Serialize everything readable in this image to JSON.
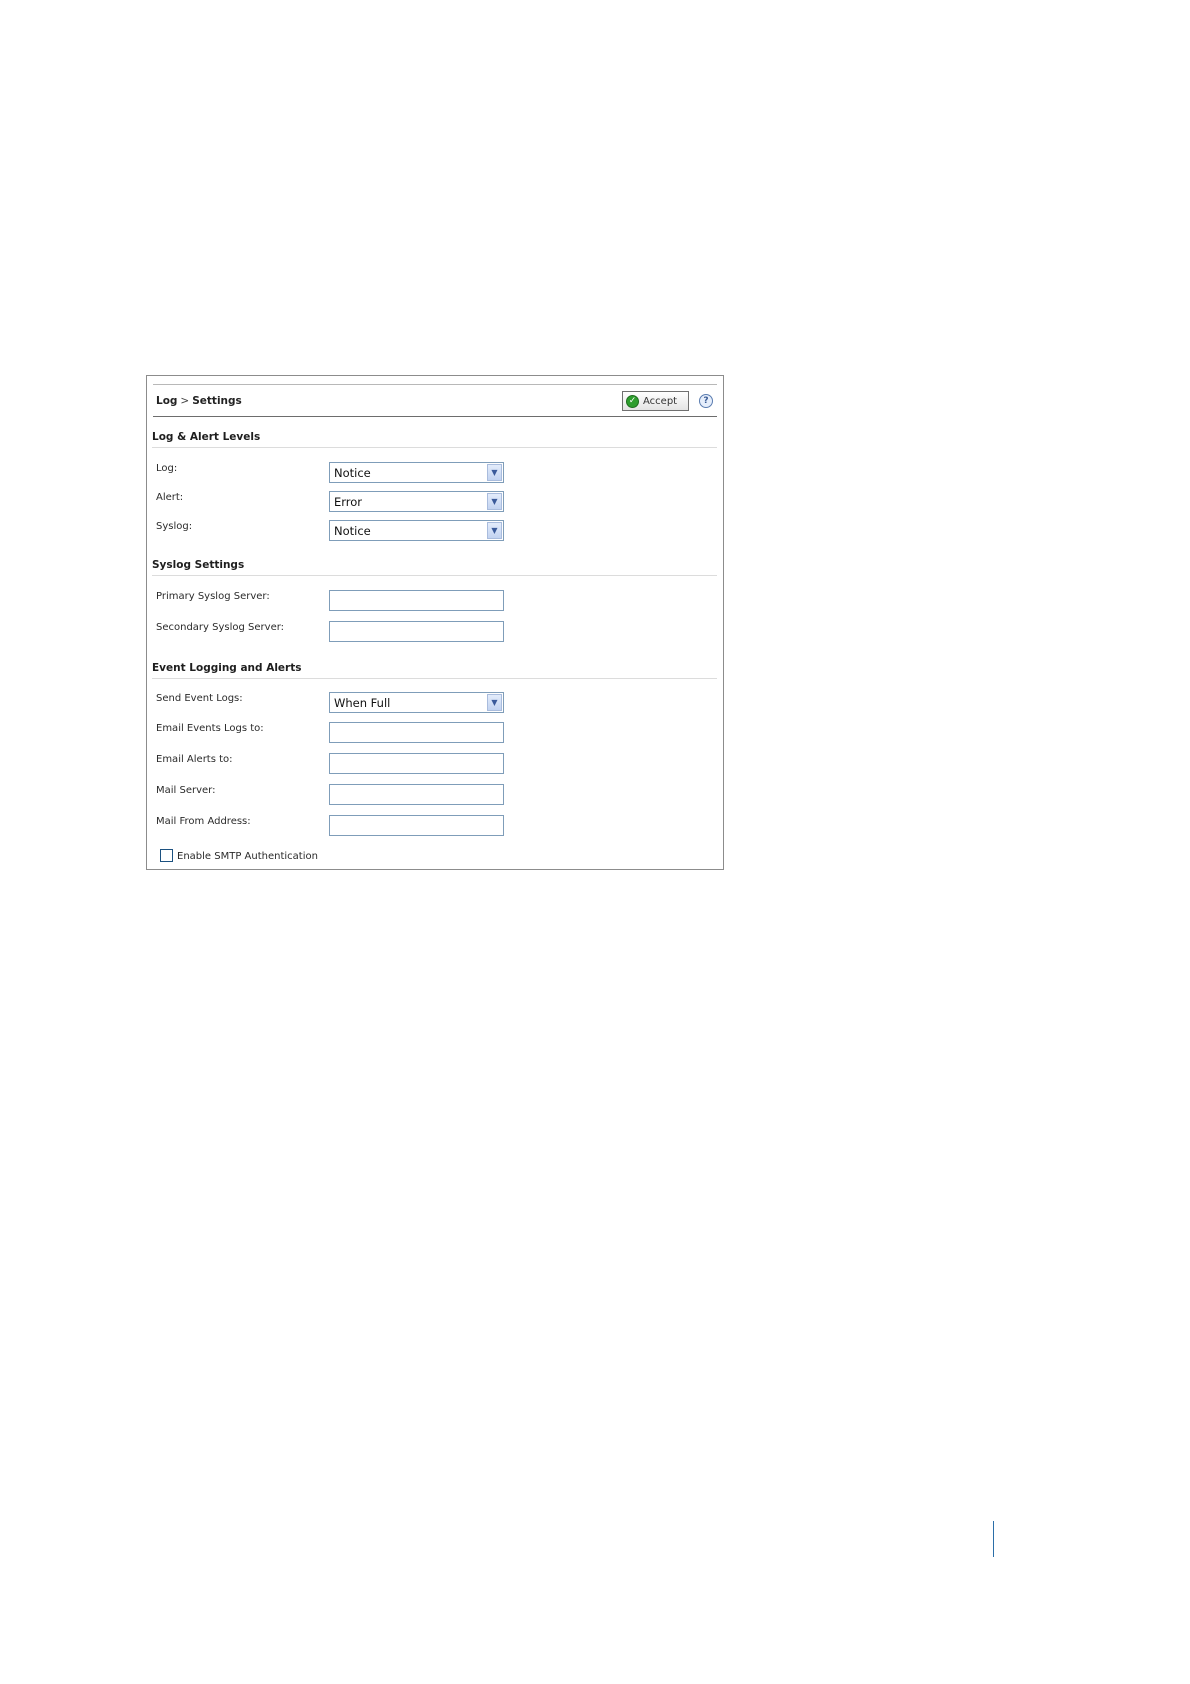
{
  "header": {
    "crumb_section": "Log",
    "crumb_separator": ">",
    "crumb_page": "Settings",
    "accept_label": "Accept",
    "accept_icon": "check-circle-icon",
    "help_icon": "help-icon",
    "help_glyph": "?"
  },
  "log_levels": {
    "title": "Log & Alert Levels",
    "log": {
      "label": "Log:",
      "value": "Notice"
    },
    "alert": {
      "label": "Alert:",
      "value": "Error"
    },
    "syslog": {
      "label": "Syslog:",
      "value": "Notice"
    }
  },
  "syslog_settings": {
    "title": "Syslog Settings",
    "primary": {
      "label": "Primary Syslog Server:",
      "value": ""
    },
    "secondary": {
      "label": "Secondary Syslog Server:",
      "value": ""
    }
  },
  "event_logging": {
    "title": "Event Logging and Alerts",
    "send_event_logs": {
      "label": "Send Event Logs:",
      "value": "When Full"
    },
    "email_events_logs": {
      "label": "Email Events Logs to:",
      "value": ""
    },
    "email_alerts": {
      "label": "Email Alerts to:",
      "value": ""
    },
    "mail_server": {
      "label": "Mail Server:",
      "value": ""
    },
    "mail_from": {
      "label": "Mail From Address:",
      "value": ""
    },
    "smtp_auth": {
      "label": "Enable SMTP Authentication",
      "checked": false
    }
  },
  "colors": {
    "field_border": "#7f9db9",
    "accept_icon_green": "#2e9e2e",
    "margin_bar": "#2b6ea8"
  }
}
